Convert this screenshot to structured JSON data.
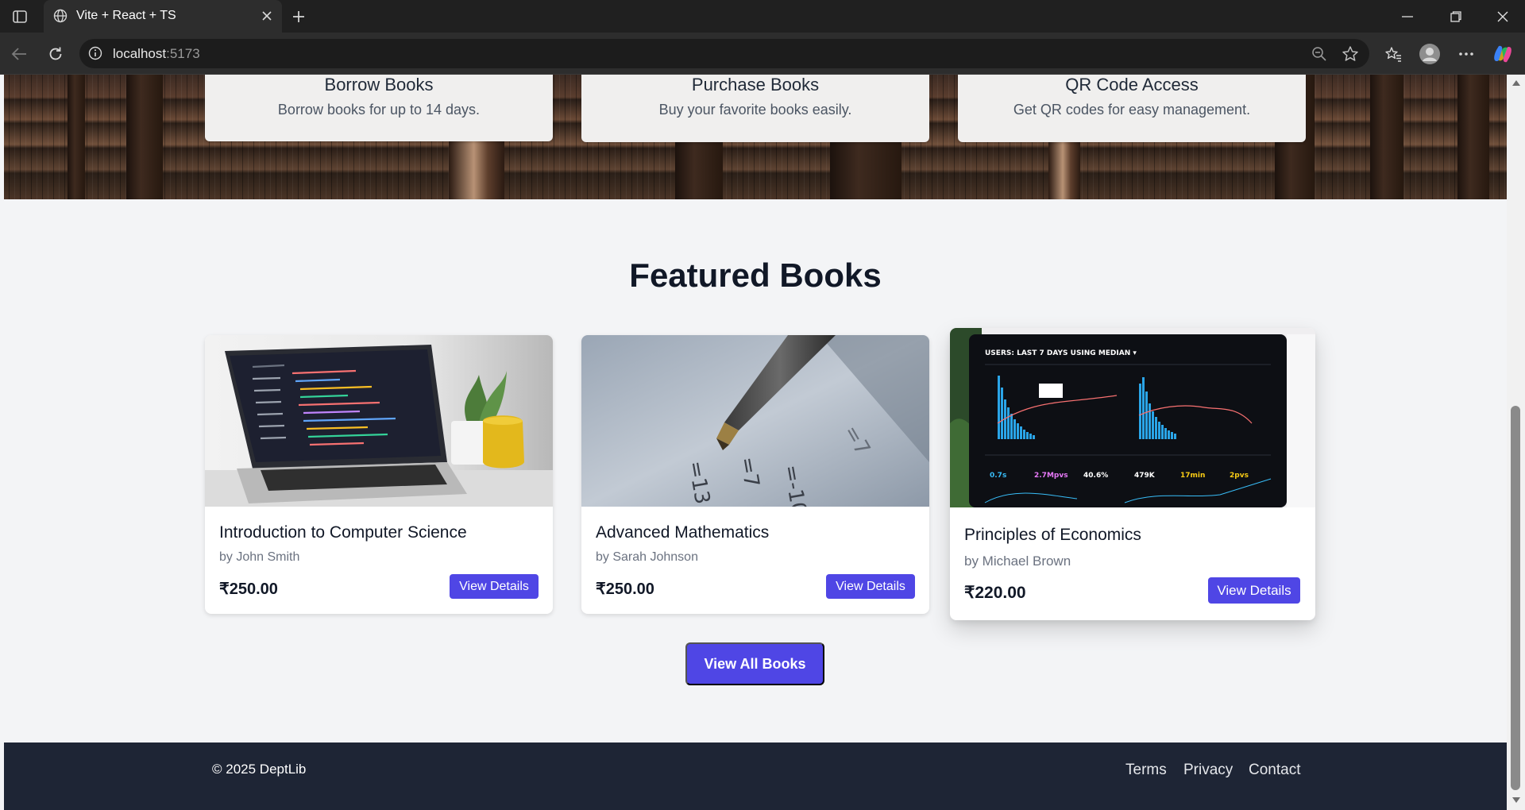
{
  "browser": {
    "tab_title": "Vite + React + TS",
    "url_host": "localhost",
    "url_port": ":5173"
  },
  "features": [
    {
      "title": "Borrow Books",
      "desc": "Borrow books for up to 14 days."
    },
    {
      "title": "Purchase Books",
      "desc": "Buy your favorite books easily."
    },
    {
      "title": "QR Code Access",
      "desc": "Get QR codes for easy management."
    }
  ],
  "featured": {
    "heading": "Featured Books",
    "books": [
      {
        "title": "Introduction to Computer Science",
        "author": "by John Smith",
        "price": "₹250.00",
        "button": "View Details",
        "image": "laptop-code-image"
      },
      {
        "title": "Advanced Mathematics",
        "author": "by Sarah Johnson",
        "price": "₹250.00",
        "button": "View Details",
        "image": "pen-on-math-paper-image"
      },
      {
        "title": "Principles of Economics",
        "author": "by Michael Brown",
        "price": "₹220.00",
        "button": "View Details",
        "image": "analytics-dashboard-image"
      }
    ],
    "view_all": "View All Books",
    "dashboard_metrics": [
      "0.7s",
      "2.7Mpvs",
      "40.6%",
      "479K",
      "17min",
      "2pvs"
    ]
  },
  "footer": {
    "copyright": "© 2025 DeptLib",
    "links": [
      "Terms",
      "Privacy",
      "Contact"
    ]
  },
  "colors": {
    "accent": "#4f46e5",
    "footer_bg": "#1e2535",
    "page_bg": "#f3f4f6"
  }
}
